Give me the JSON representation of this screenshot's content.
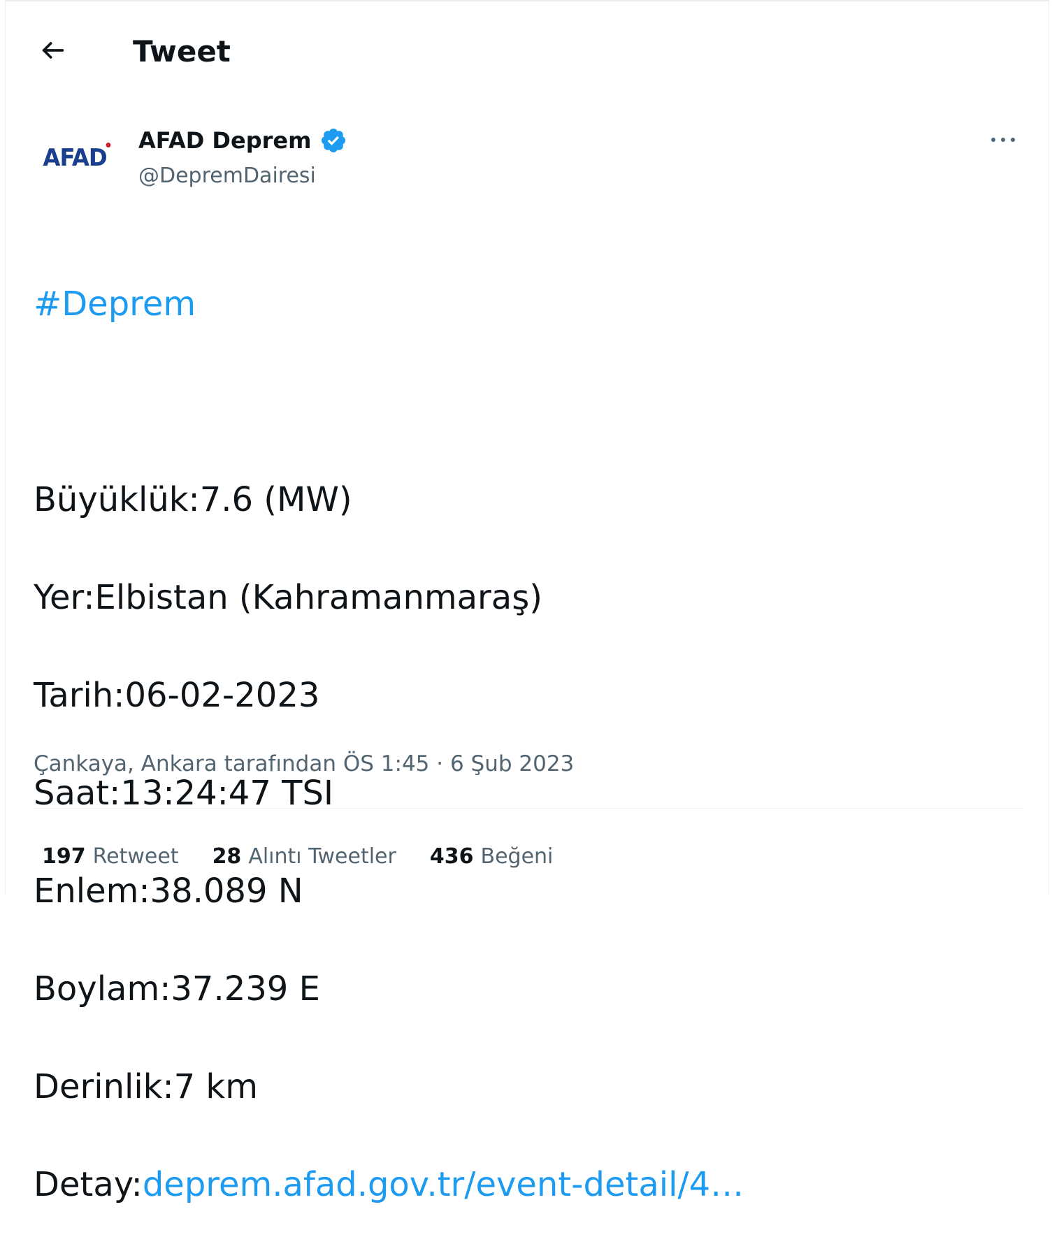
{
  "header": {
    "title": "Tweet",
    "back_icon": "arrow-left-icon"
  },
  "author": {
    "avatar_text": "AFAD",
    "display_name": "AFAD Deprem",
    "handle": "@DepremDairesi",
    "verified_icon": "verified-badge-icon",
    "colors": {
      "logo_blue": "#1a3f8f",
      "logo_red_dot": "#d51b2a",
      "verified_blue": "#1d9bf0"
    }
  },
  "more_icon": "more-horizontal-icon",
  "tweet": {
    "hashtag": "#Deprem",
    "lines": [
      "Büyüklük:7.6 (MW)",
      "Yer:Elbistan (Kahramanmaraş)",
      "Tarih:06-02-2023",
      "Saat:13:24:47 TSI",
      "Enlem:38.089 N",
      "Boylam:37.239 E",
      "Derinlik:7 km"
    ],
    "detail_label": "Detay:",
    "detail_link": "deprem.afad.gov.tr/event-detail/4…",
    "link_color": "#1d9bf0"
  },
  "meta": {
    "text": "Çankaya, Ankara tarafından ÖS 1:45 · 6 Şub 2023"
  },
  "stats": {
    "retweets_count": "197",
    "retweets_label": "Retweet",
    "quotes_count": "28",
    "quotes_label": "Alıntı Tweetler",
    "likes_count": "436",
    "likes_label": "Beğeni"
  }
}
